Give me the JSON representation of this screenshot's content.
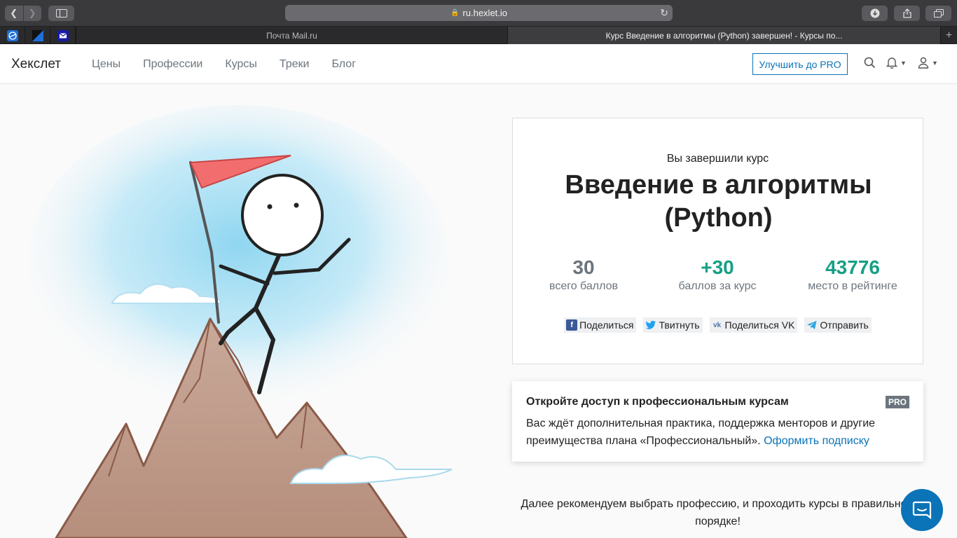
{
  "browser": {
    "url": "ru.hexlet.io",
    "tabs": [
      {
        "title": "Почта Mail.ru"
      },
      {
        "title": "Курс Введение в алгоритмы (Python) завершен! - Курсы по..."
      }
    ]
  },
  "header": {
    "logo": "Хекслет",
    "nav": [
      "Цены",
      "Профессии",
      "Курсы",
      "Треки",
      "Блог"
    ],
    "upgrade_label": "Улучшить до PRO"
  },
  "completion": {
    "subtitle": "Вы завершили курс",
    "course_title": "Введение в алгоритмы (Python)",
    "stats": [
      {
        "value": "30",
        "label": "всего баллов",
        "color": "#6c757d"
      },
      {
        "value": "+30",
        "label": "баллов за курс",
        "color": "#16a085"
      },
      {
        "value": "43776",
        "label": "место в рейтинге",
        "color": "#16a085"
      }
    ],
    "shares": [
      {
        "label": "Поделиться",
        "icon": "facebook-icon"
      },
      {
        "label": "Твитнуть",
        "icon": "twitter-icon"
      },
      {
        "label": "Поделиться VK",
        "icon": "vk-icon"
      },
      {
        "label": "Отправить",
        "icon": "telegram-icon"
      }
    ]
  },
  "pro": {
    "title": "Откройте доступ к профессиональным курсам",
    "badge": "PRO",
    "text": "Вас ждёт дополнительная практика, поддержка менторов и другие преимущества плана «Профессиональный».",
    "link": "Оформить подписку"
  },
  "recommend": {
    "line1": "Далее рекомендуем выбрать профессию, и проходить курсы в правильном",
    "line2": "порядке!"
  },
  "colors": {
    "accent": "#0b73b7",
    "success": "#16a085",
    "muted": "#6c757d"
  }
}
